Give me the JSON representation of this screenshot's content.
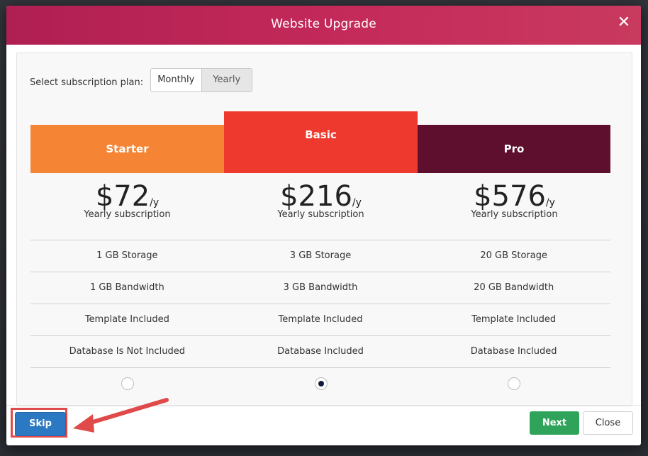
{
  "modal": {
    "title": "Website Upgrade",
    "close_icon": "close-icon"
  },
  "plan_select": {
    "label": "Select subscription plan:",
    "options": [
      "Monthly",
      "Yearly"
    ],
    "selected": "Yearly"
  },
  "plans": [
    {
      "name": "Starter",
      "color": "#f58535",
      "price": "$72",
      "period": "/y",
      "subscription": "Yearly subscription",
      "features": [
        "1 GB Storage",
        "1 GB Bandwidth",
        "Template Included",
        "Database Is Not Included"
      ],
      "selected": false
    },
    {
      "name": "Basic",
      "color": "#ee3a2e",
      "price": "$216",
      "period": "/y",
      "subscription": "Yearly subscription",
      "features": [
        "3 GB Storage",
        "3 GB Bandwidth",
        "Template Included",
        "Database Included"
      ],
      "selected": true
    },
    {
      "name": "Pro",
      "color": "#5f0f2e",
      "price": "$576",
      "period": "/y",
      "subscription": "Yearly subscription",
      "features": [
        "20 GB Storage",
        "20 GB Bandwidth",
        "Template Included",
        "Database Included"
      ],
      "selected": false
    }
  ],
  "footer": {
    "skip_label": "Skip",
    "next_label": "Next",
    "close_label": "Close"
  },
  "colors": {
    "header": "#b01f52",
    "skip": "#2b79c2",
    "next": "#2fa35a",
    "highlight": "#e04a4a"
  }
}
